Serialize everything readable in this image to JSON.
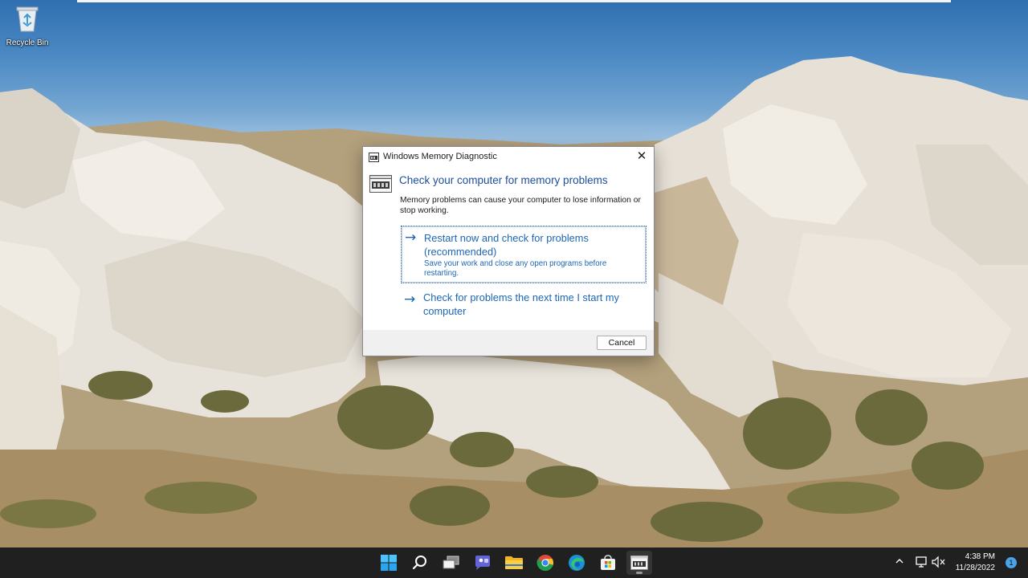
{
  "desktop": {
    "icons": [
      {
        "label": "Recycle Bin",
        "icon": "recycle-bin-icon"
      }
    ]
  },
  "dialog": {
    "title": "Windows Memory Diagnostic",
    "heading": "Check your computer for memory problems",
    "description": "Memory problems can cause your computer to lose information or stop working.",
    "options": [
      {
        "title": "Restart now and check for problems (recommended)",
        "subtitle": "Save your work and close any open programs before restarting.",
        "icon": "arrow-right-icon"
      },
      {
        "title": "Check for problems the next time I start my computer",
        "icon": "arrow-right-icon"
      }
    ],
    "cancel_label": "Cancel",
    "close_glyph": "✕"
  },
  "taskbar": {
    "apps": [
      {
        "name": "Start",
        "icon": "windows-start-icon"
      },
      {
        "name": "Search",
        "icon": "search-icon"
      },
      {
        "name": "Task View",
        "icon": "task-view-icon"
      },
      {
        "name": "Chat",
        "icon": "chat-icon"
      },
      {
        "name": "File Explorer",
        "icon": "folder-icon"
      },
      {
        "name": "Chrome",
        "icon": "chrome-icon"
      },
      {
        "name": "Edge",
        "icon": "edge-icon"
      },
      {
        "name": "Microsoft Store",
        "icon": "store-icon"
      },
      {
        "name": "Windows Memory Diagnostic",
        "icon": "memory-diagnostic-icon",
        "active": true
      }
    ],
    "tray": {
      "chevron": "^",
      "time": "4:38 PM",
      "date": "11/28/2022",
      "notification_count": "1"
    }
  },
  "colors": {
    "accent_link": "#1c66b4",
    "heading": "#1c4e9c",
    "taskbar": "#202020"
  }
}
